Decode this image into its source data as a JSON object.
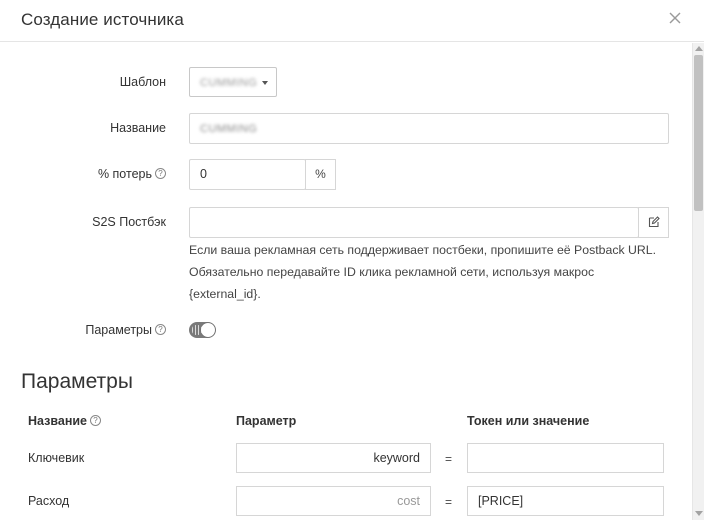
{
  "modal": {
    "title": "Создание источника"
  },
  "form": {
    "template": {
      "label": "Шаблон",
      "value": "CUMMING"
    },
    "name": {
      "label": "Название",
      "value": "CUMMING"
    },
    "loss": {
      "label": "% потерь",
      "value": "0",
      "unit": "%"
    },
    "postback": {
      "label": "S2S Постбэк",
      "value": "",
      "hint_line1": "Если ваша рекламная сеть поддерживает постбеки, пропишите её Postback URL.",
      "hint_line2": "Обязательно передавайте ID клика рекламной сети, используя макрос",
      "hint_line3": "{external_id}."
    },
    "params_toggle": {
      "label": "Параметры",
      "enabled": true
    }
  },
  "params_section": {
    "title": "Параметры",
    "columns": {
      "name": "Название",
      "param": "Параметр",
      "token": "Токен или значение"
    },
    "rows": [
      {
        "name": "Ключевик",
        "param": "keyword",
        "token": ""
      },
      {
        "name": "Расход",
        "param": "cost",
        "token": "[PRICE]"
      }
    ],
    "equals": "="
  },
  "icons": {
    "close": "close-icon",
    "help": "question-circle-icon",
    "edit": "edit-icon",
    "dropdown": "chevron-down-icon"
  },
  "colors": {
    "toggle_on": "#7a7a7a",
    "border": "#d6d6d6"
  }
}
